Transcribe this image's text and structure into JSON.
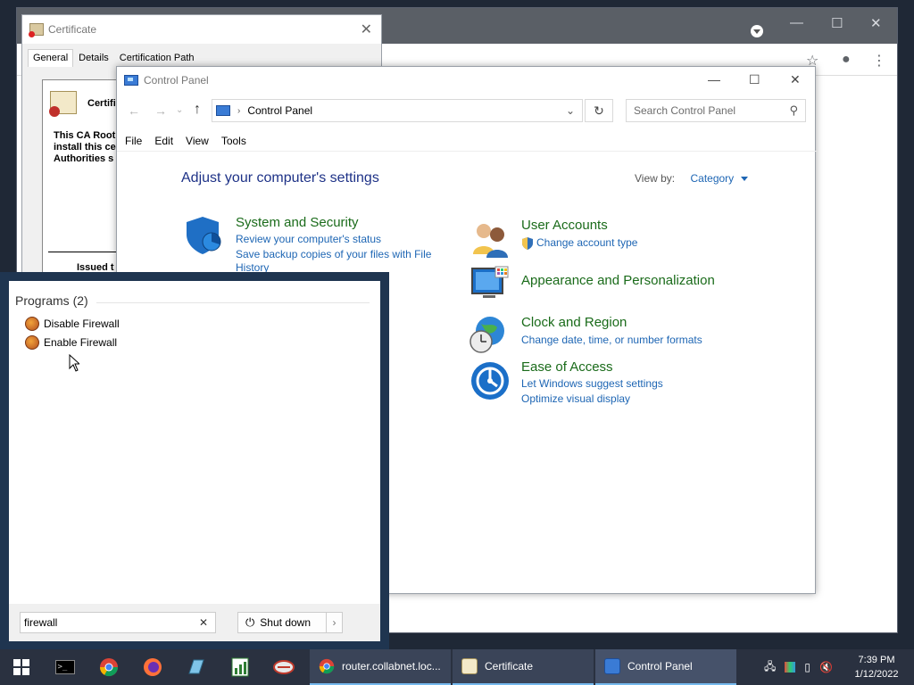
{
  "browser": {
    "tab_title": "router.collabnet.loc..."
  },
  "certificate": {
    "title": "Certificate",
    "tabs": [
      "General",
      "Details",
      "Certification Path"
    ],
    "info_heading": "Certific",
    "warning_lines": [
      "This CA Root",
      "install this ce",
      "Authorities s"
    ],
    "issued_to": "Issued t"
  },
  "control_panel": {
    "title": "Control Panel",
    "address": "Control Panel",
    "search_placeholder": "Search Control Panel",
    "menu": [
      "File",
      "Edit",
      "View",
      "Tools"
    ],
    "heading": "Adjust your computer's settings",
    "view_by_label": "View by:",
    "view_by_value": "Category",
    "categories": [
      {
        "title": "System and Security",
        "links": [
          "Review your computer's status",
          "Save backup copies of your files with File",
          "History"
        ]
      },
      {
        "title": "User Accounts",
        "links": [
          "Change account type"
        ]
      },
      {
        "title": "Appearance and Personalization",
        "links": []
      },
      {
        "title": "Clock and Region",
        "links": [
          "Change date, time, or number formats"
        ]
      },
      {
        "title": "Ease of Access",
        "links": [
          "Let Windows suggest settings",
          "Optimize visual display"
        ]
      }
    ]
  },
  "start_menu": {
    "programs_heading": "Programs (2)",
    "programs": [
      "Disable Firewall",
      "Enable Firewall"
    ],
    "search_value": "firewall",
    "shutdown_label": "Shut down"
  },
  "taskbar": {
    "tasks": [
      {
        "label": "router.collabnet.loc...",
        "icon": "chrome-icon"
      },
      {
        "label": "Certificate",
        "icon": "certificate-icon"
      },
      {
        "label": "Control Panel",
        "icon": "control-panel-icon"
      }
    ],
    "time": "7:39 PM",
    "date": "1/12/2022"
  }
}
